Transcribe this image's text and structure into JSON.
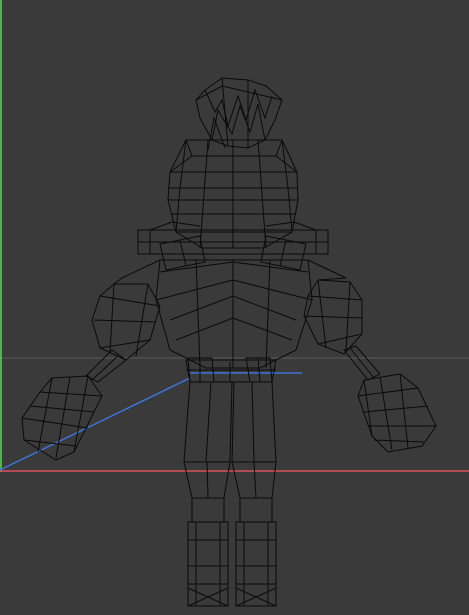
{
  "viewport": {
    "background_color": "#3a3a3a",
    "grid_line_color": "#5a5a5a",
    "x_axis_color": "#d9535a",
    "y_axis_color": "#4fb34f",
    "z_axis_color": "#3f73d6",
    "wireframe_color": "#0a0a0a",
    "model": "robot-character-wireframe"
  }
}
